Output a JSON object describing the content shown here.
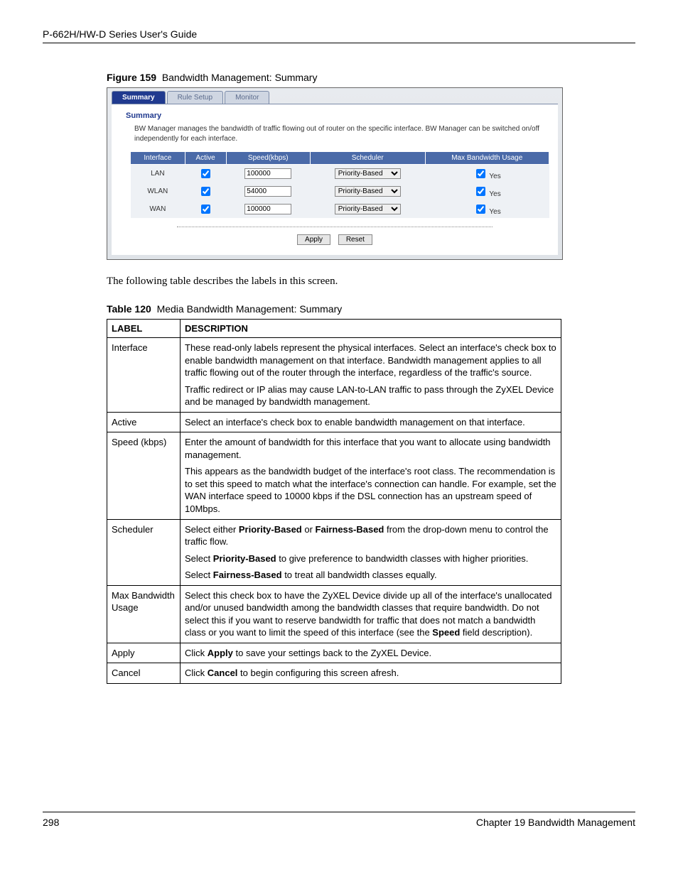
{
  "header": {
    "title": "P-662H/HW-D Series User's Guide"
  },
  "figure": {
    "label": "Figure 159",
    "title": "Bandwidth Management: Summary"
  },
  "ui": {
    "tabs": [
      "Summary",
      "Rule Setup",
      "Monitor"
    ],
    "active_tab": 0,
    "panel_title": "Summary",
    "panel_desc": "BW Manager manages the bandwidth of traffic flowing out of router on the specific interface. BW Manager can be switched on/off independently for each interface.",
    "columns": [
      "Interface",
      "Active",
      "Speed(kbps)",
      "Scheduler",
      "Max Bandwidth Usage"
    ],
    "rows": [
      {
        "iface": "LAN",
        "active": true,
        "speed": "100000",
        "scheduler": "Priority-Based",
        "max_label": "Yes",
        "max_checked": true
      },
      {
        "iface": "WLAN",
        "active": true,
        "speed": "54000",
        "scheduler": "Priority-Based",
        "max_label": "Yes",
        "max_checked": true
      },
      {
        "iface": "WAN",
        "active": true,
        "speed": "100000",
        "scheduler": "Priority-Based",
        "max_label": "Yes",
        "max_checked": true
      }
    ],
    "scheduler_options": [
      "Priority-Based",
      "Fairness-Based"
    ],
    "buttons": {
      "apply": "Apply",
      "reset": "Reset"
    }
  },
  "body_text": "The following table describes the labels in this screen.",
  "table_caption": {
    "label": "Table 120",
    "title": "Media Bandwidth Management: Summary"
  },
  "desc_table": {
    "headers": [
      "LABEL",
      "DESCRIPTION"
    ],
    "rows": [
      {
        "label": "Interface",
        "paras": [
          {
            "segments": [
              {
                "t": "These read-only labels represent the physical interfaces. Select an interface's check box to enable bandwidth management on that interface. Bandwidth management applies to all traffic flowing out of the router through the interface, regardless of the traffic's source."
              }
            ]
          },
          {
            "segments": [
              {
                "t": "Traffic redirect or IP alias may cause LAN-to-LAN traffic to pass through the ZyXEL Device and be managed by bandwidth management."
              }
            ]
          }
        ]
      },
      {
        "label": "Active",
        "paras": [
          {
            "segments": [
              {
                "t": "Select an interface's check box to enable bandwidth management on that interface."
              }
            ]
          }
        ]
      },
      {
        "label": "Speed (kbps)",
        "paras": [
          {
            "segments": [
              {
                "t": "Enter the amount of bandwidth for this interface that you want to allocate using bandwidth management."
              }
            ]
          },
          {
            "segments": [
              {
                "t": "This appears as the bandwidth budget of the interface's root class. The recommendation is to set this speed to match what the interface's connection can handle. For example, set the WAN interface speed to 10000 kbps if the DSL connection has an upstream speed of 10Mbps."
              }
            ]
          }
        ]
      },
      {
        "label": "Scheduler",
        "paras": [
          {
            "segments": [
              {
                "t": "Select either "
              },
              {
                "t": "Priority-Based",
                "b": true
              },
              {
                "t": " or "
              },
              {
                "t": "Fairness-Based",
                "b": true
              },
              {
                "t": " from the drop-down menu to control the traffic flow."
              }
            ]
          },
          {
            "segments": [
              {
                "t": "Select "
              },
              {
                "t": "Priority-Based",
                "b": true
              },
              {
                "t": " to give preference to bandwidth classes with higher priorities."
              }
            ]
          },
          {
            "segments": [
              {
                "t": "Select "
              },
              {
                "t": "Fairness-Based",
                "b": true
              },
              {
                "t": " to treat all bandwidth classes equally."
              }
            ]
          }
        ]
      },
      {
        "label": "Max Bandwidth Usage",
        "paras": [
          {
            "segments": [
              {
                "t": "Select this check box to have the ZyXEL Device divide up all of the interface's unallocated and/or unused bandwidth among the bandwidth classes that require bandwidth. Do not select this if you want to reserve bandwidth for traffic that does not match a bandwidth class or you want to limit the speed of this interface (see the "
              },
              {
                "t": "Speed",
                "b": true
              },
              {
                "t": " field description)."
              }
            ]
          }
        ]
      },
      {
        "label": "Apply",
        "paras": [
          {
            "segments": [
              {
                "t": "Click "
              },
              {
                "t": "Apply",
                "b": true
              },
              {
                "t": " to save your settings back to the ZyXEL Device."
              }
            ]
          }
        ]
      },
      {
        "label": "Cancel",
        "paras": [
          {
            "segments": [
              {
                "t": "Click "
              },
              {
                "t": "Cancel",
                "b": true
              },
              {
                "t": " to begin configuring this screen afresh."
              }
            ]
          }
        ]
      }
    ]
  },
  "footer": {
    "page": "298",
    "chapter": "Chapter 19 Bandwidth Management"
  }
}
